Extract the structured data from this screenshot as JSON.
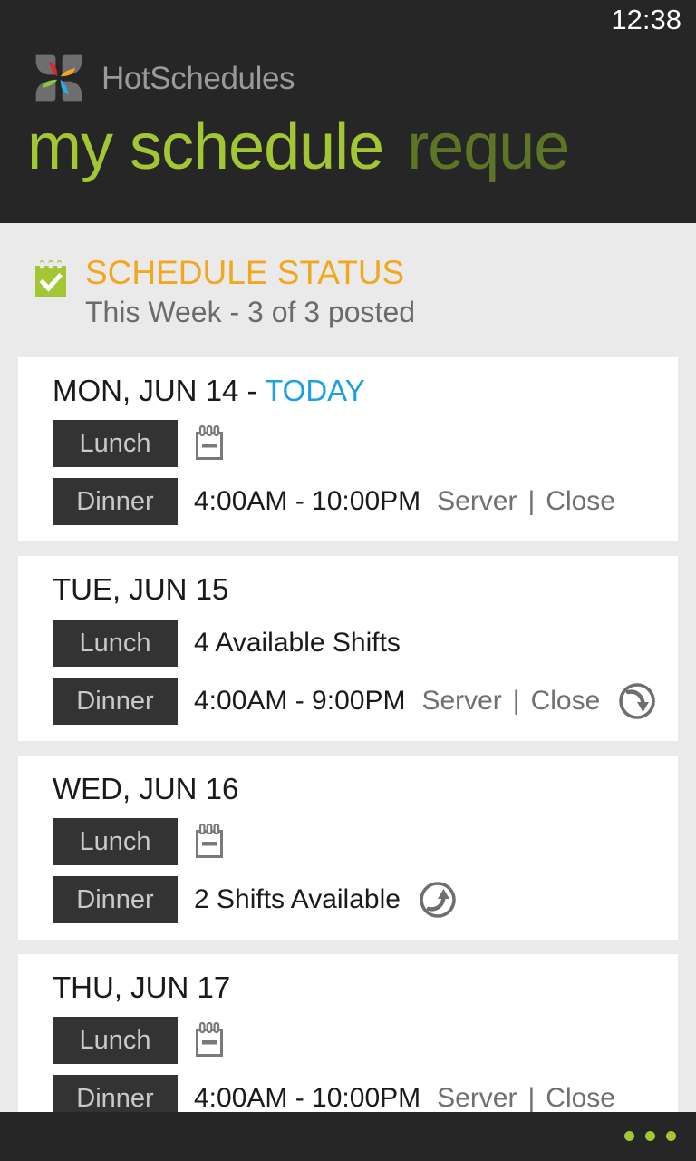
{
  "status_bar": {
    "clock": "12:38"
  },
  "brand": {
    "name": "HotSchedules",
    "logo_icon": "hotschedules-flower-logo"
  },
  "pivot": {
    "active": "my schedule",
    "inactive": "reque"
  },
  "schedule_status": {
    "icon": "calendar-check-icon",
    "title": "SCHEDULE STATUS",
    "subtitle": "This Week - 3 of 3 posted"
  },
  "colors": {
    "accent_green": "#A2C634",
    "dim_green": "#5E7526",
    "today_blue": "#1BA1E2",
    "status_orange": "#F0A81E",
    "chrome_dark": "#262626",
    "badge_dark": "#333333",
    "page_bg": "#EAEAEA",
    "card_bg": "#FFFFFF",
    "muted_text": "#707070"
  },
  "days": [
    {
      "date": "MON, JUN 14 - ",
      "today_label": "TODAY",
      "rows": [
        {
          "meal": "Lunch",
          "kind": "empty",
          "empty_icon": "calendar-minus-icon"
        },
        {
          "meal": "Dinner",
          "kind": "shift",
          "time": "4:00AM - 10:00PM",
          "role": "Server",
          "sep": "|",
          "station": "Close"
        }
      ]
    },
    {
      "date": "TUE, JUN 15",
      "today_label": "",
      "rows": [
        {
          "meal": "Lunch",
          "kind": "text",
          "text": "4 Available Shifts"
        },
        {
          "meal": "Dinner",
          "kind": "shift",
          "time": "4:00AM - 9:00PM",
          "role": "Server",
          "sep": "|",
          "station": "Close",
          "action_icon": "pickup-shift-down-arrow-icon"
        }
      ]
    },
    {
      "date": "WED, JUN 16",
      "today_label": "",
      "rows": [
        {
          "meal": "Lunch",
          "kind": "empty",
          "empty_icon": "calendar-minus-icon"
        },
        {
          "meal": "Dinner",
          "kind": "text",
          "text": "2 Shifts Available",
          "action_icon": "release-shift-up-arrow-icon"
        }
      ]
    },
    {
      "date": "THU, JUN 17",
      "today_label": "",
      "rows": [
        {
          "meal": "Lunch",
          "kind": "empty",
          "empty_icon": "calendar-minus-icon"
        },
        {
          "meal": "Dinner",
          "kind": "shift",
          "time": "4:00AM - 10:00PM",
          "role": "Server",
          "sep": "|",
          "station": "Close"
        }
      ]
    }
  ],
  "appbar": {
    "more_icon": "ellipsis-more-icon"
  }
}
